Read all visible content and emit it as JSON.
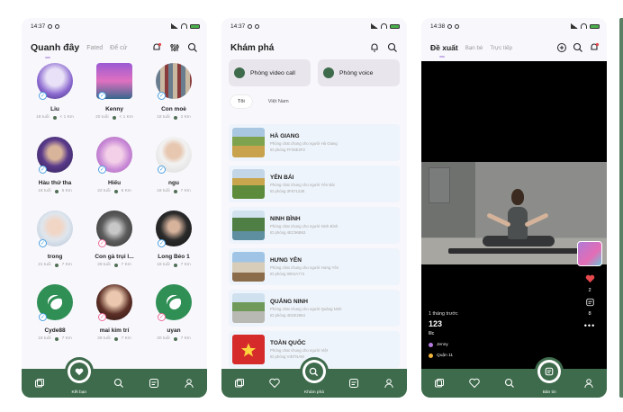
{
  "screens": [
    {
      "status_time": "14:37",
      "title": "Quanh đây",
      "tabs": [
        "Fated",
        "Để cử"
      ],
      "people": [
        {
          "name": "Liu",
          "age": "18 tuổi",
          "distance": "< 1 Km",
          "verified": "blue"
        },
        {
          "name": "Kenny",
          "age": "20 tuổi",
          "distance": "< 1 Km",
          "verified": "pink"
        },
        {
          "name": "Con moè",
          "age": "18 tuổi",
          "distance": "2 Km",
          "verified": "blue"
        },
        {
          "name": "Hàu thứ tha",
          "age": "18 tuổi",
          "distance": "5 Km",
          "verified": "blue"
        },
        {
          "name": "Hiếu",
          "age": "22 tuổi",
          "distance": "6 Km",
          "verified": "blue"
        },
        {
          "name": "ngu",
          "age": "18 tuổi",
          "distance": "7 Km",
          "verified": "blue"
        },
        {
          "name": "trong",
          "age": "21 tuổi",
          "distance": "7 Km",
          "verified": "blue"
        },
        {
          "name": "Con gà trụi l...",
          "age": "28 tuổi",
          "distance": "7 Km",
          "verified": "pink"
        },
        {
          "name": "Long Béo 1",
          "age": "18 tuổi",
          "distance": "7 Km",
          "verified": "blue"
        },
        {
          "name": "Cyde88",
          "age": "18 tuổi",
          "distance": "7 Km",
          "verified": "blue"
        },
        {
          "name": "mai kim trí",
          "age": "28 tuổi",
          "distance": "7 Km",
          "verified": "pink"
        },
        {
          "name": "uyan",
          "age": "20 tuổi",
          "distance": "7 Km",
          "verified": "pink"
        }
      ],
      "nav_center_label": "Kết bạn"
    },
    {
      "status_time": "14:37",
      "title": "Khám phá",
      "video_call": "Phòng video call",
      "voice_room": "Phòng voice",
      "filters": [
        "Tôi",
        "Việt Nam"
      ],
      "rooms": [
        {
          "name": "HÀ GIANG",
          "desc": "Phòng chat chung cho người Hà Giang",
          "id": "ID phòng FF26E2F2"
        },
        {
          "name": "YÊN BÁI",
          "desc": "Phòng chat chung cho người Yên Bái",
          "id": "ID phòng 3F67123E"
        },
        {
          "name": "NINH BÌNH",
          "desc": "Phòng chat chung cho người Ninh Bình",
          "id": "ID phòng 4EC96B63"
        },
        {
          "name": "HƯNG YÊN",
          "desc": "Phòng chat chung cho người Hưng Yên",
          "id": "ID phòng 0904A772"
        },
        {
          "name": "QUẢNG NINH",
          "desc": "Phòng chat chung cho người Quảng Ninh",
          "id": "ID phòng 4D2E2864"
        },
        {
          "name": "TOÀN QUỐC",
          "desc": "Phòng chat chung cho người Việt",
          "id": "ID phòng VIETNAM"
        }
      ],
      "nav_center_label": "Khám phá"
    },
    {
      "status_time": "14:38",
      "title": "Đề xuất",
      "tabs": [
        "Bạn bè",
        "Trực tiếp"
      ],
      "likes": "2",
      "comments": "8",
      "post_time": "1 tháng trước",
      "post_title": "123",
      "post_sub": "lllc",
      "user_name": "Jenny",
      "user_location": "Quận 11",
      "nav_center_label": "Bản tin"
    }
  ]
}
